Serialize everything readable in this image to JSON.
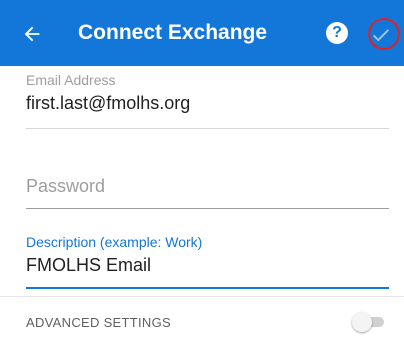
{
  "appbar": {
    "title": "Connect Exchange",
    "back_icon": "arrow-left-icon",
    "help_icon": "help-circle-icon",
    "help_glyph": "?",
    "confirm_icon": "checkmark-icon"
  },
  "form": {
    "email": {
      "label": "Email Address",
      "value": "first.last@fmolhs.org"
    },
    "password": {
      "placeholder": "Password",
      "value": ""
    },
    "description": {
      "label": "Description (example: Work)",
      "value": "FMOLHS Email"
    }
  },
  "advanced": {
    "label": "ADVANCED SETTINGS",
    "enabled": false
  },
  "colors": {
    "brand": "#1377d9",
    "highlight_ring": "#d6262b",
    "label_gray": "#9e9e9e",
    "text": "#212121"
  }
}
